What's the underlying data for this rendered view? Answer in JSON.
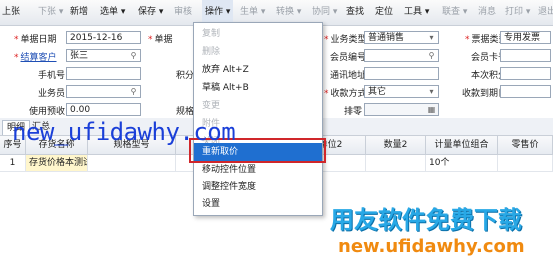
{
  "toolbar": {
    "items": [
      {
        "label": "上张",
        "disabled": false
      },
      {
        "label": "下张 ▾",
        "disabled": true
      },
      {
        "label": "新增",
        "disabled": false
      },
      {
        "label": "选单 ▾",
        "disabled": false
      },
      {
        "label": "保存 ▾",
        "disabled": false
      },
      {
        "label": "审核",
        "disabled": true
      },
      {
        "label": "操作 ▾",
        "disabled": false
      },
      {
        "label": "生单 ▾",
        "disabled": true
      },
      {
        "label": "转换 ▾",
        "disabled": true
      },
      {
        "label": "协同 ▾",
        "disabled": true
      },
      {
        "label": "查找",
        "disabled": false
      },
      {
        "label": "定位",
        "disabled": false
      },
      {
        "label": "工具 ▾",
        "disabled": false
      },
      {
        "label": "联查 ▾",
        "disabled": true
      },
      {
        "label": "消息",
        "disabled": true
      },
      {
        "label": "打印 ▾",
        "disabled": true
      },
      {
        "label": "退出",
        "disabled": true
      }
    ]
  },
  "form": {
    "doc_date_label": "单据日期",
    "doc_date_value": "2015-12-16",
    "customer_label": "结算客户",
    "customer_value": "张三",
    "phone_label": "手机号",
    "salesman_label": "业务员",
    "prepay_label": "使用预收",
    "prepay_value": "0.00",
    "doc_no_label": "单据",
    "points_label": "积分",
    "spec_label": "规格",
    "biz_type_label": "业务类型",
    "biz_type_value": "普通销售",
    "member_no_label": "会员编号",
    "address_label": "通讯地址",
    "payment_label": "收款方式",
    "payment_value": "其它",
    "arrange_label": "排零",
    "invoice_type_label": "票据类型",
    "invoice_type_value": "专用发票",
    "member_card_label": "会员卡号",
    "current_points_label": "本次积分",
    "receipt_date_label": "收款到期日"
  },
  "tabs": [
    {
      "label": "明细",
      "active": true
    },
    {
      "label": "汇总",
      "active": false
    }
  ],
  "grid": {
    "headers": [
      "序号",
      "存货名称",
      "规格型号",
      "销售",
      "单位2",
      "数量2",
      "计量单位组合",
      "零售价"
    ],
    "rows": [
      {
        "no": "1",
        "name": "存货价格本测试",
        "spec": "",
        "sale": "个",
        "unit2": "",
        "qty2": "",
        "unit_group": "10个",
        "price": ""
      }
    ]
  },
  "menu": {
    "items": [
      {
        "label": "复制",
        "disabled": true
      },
      {
        "label": "删除",
        "disabled": true
      },
      {
        "label": "放弃  Alt+Z",
        "disabled": false
      },
      {
        "label": "草稿  Alt+B",
        "disabled": false
      },
      {
        "label": "变更",
        "disabled": true
      },
      {
        "label": "附件",
        "disabled": true
      },
      {
        "label": "关闭",
        "disabled": true
      },
      {
        "label": "重新取价",
        "disabled": false,
        "highlighted": true
      },
      {
        "label": "移动控件位置",
        "disabled": false
      },
      {
        "label": "调整控件宽度",
        "disabled": false
      },
      {
        "label": "设置",
        "disabled": false
      }
    ]
  },
  "watermark": {
    "url_top": "new_ufidawhy.com",
    "brand_cn": "用友软件免费下载",
    "url_bottom": "new.ufidawhy.com"
  },
  "colors": {
    "highlight": "#1f6fd0",
    "redbox": "#d0262a",
    "required": "#d22"
  }
}
